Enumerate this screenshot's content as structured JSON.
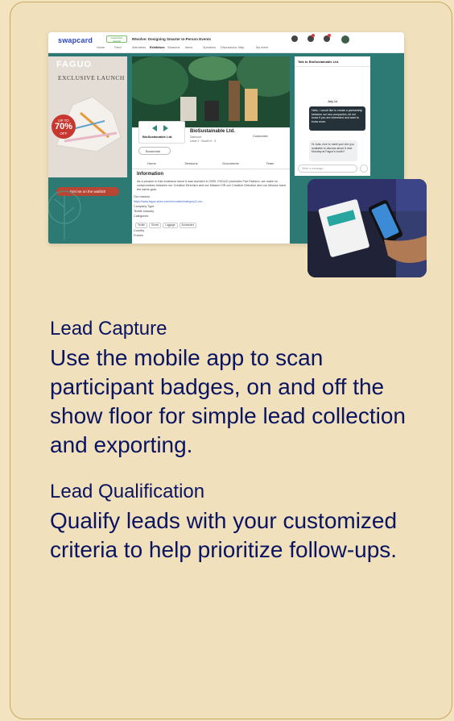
{
  "mockup": {
    "logo": "swapcard",
    "partner_label": "GreenTech Awards",
    "event_title": "Rēvolve: Designing Smarter In-Person Events",
    "nav": [
      "Home",
      "Feed",
      "Attendees",
      "Exhibitors",
      "Sessions",
      "Items",
      "Speakers",
      "Discussions",
      "Map",
      "My event"
    ],
    "promo": {
      "brand": "FAGUO",
      "headline": "EXCLUSIVE LAUNCH",
      "badge_upto": "UP TO",
      "badge_pct": "70%",
      "badge_off": "OFF",
      "cta": "Get me on the waitlist!"
    },
    "company": {
      "card_name": "BioSustainable Ltd.",
      "name": "BioSustainable Ltd.",
      "level": "Diamond",
      "location": "Level 1 · Booth H · 3",
      "customize": "Customize",
      "bookmark": "Bookmark",
      "tabs": [
        "Home",
        "Sessions",
        "Documents",
        "Team"
      ],
      "info_title": "Information",
      "info_text": "As a pioneer in this endeavor since it was founded in 2009, FAGUO promotes Fair Fashion: we make no compromises between our Creative Direction and our Mission OR our Creative Direction and our Mission have the same goal.",
      "our_mission": "Our mission",
      "link": "https://www.faguo-store.com/en/content/category/2-our...",
      "company_type_label": "Company Type",
      "company_type": "Textile industry",
      "categories_label": "Categories",
      "tags": [
        "Textile",
        "Shoes",
        "Luggage",
        "Accessoirs"
      ],
      "country_label": "Country",
      "country": "France"
    },
    "chat": {
      "title": "Talk to BioSustainable Ltd.",
      "date": "July 14",
      "msg1": "Hello, I would like to create a partnership between our two companies, let me know if you are interested and want to know more.",
      "msg2": "Hi Julia, nice to meet you! Are you available to discuss about it next Monday at Faguo's booth?",
      "input_placeholder": "Write a message..."
    }
  },
  "features": [
    {
      "title": "Lead Capture",
      "body": "Use the mobile app to scan participant badges, on and off the show floor for simple lead collection and exporting."
    },
    {
      "title": "Lead Qualification",
      "body": "Qualify leads with your customized criteria to help prioritize follow-ups."
    }
  ],
  "colors": {
    "card_bg": "#f0e0bc",
    "card_border": "#c8a85e",
    "text": "#0a1460",
    "teal": "#2d7a75"
  }
}
